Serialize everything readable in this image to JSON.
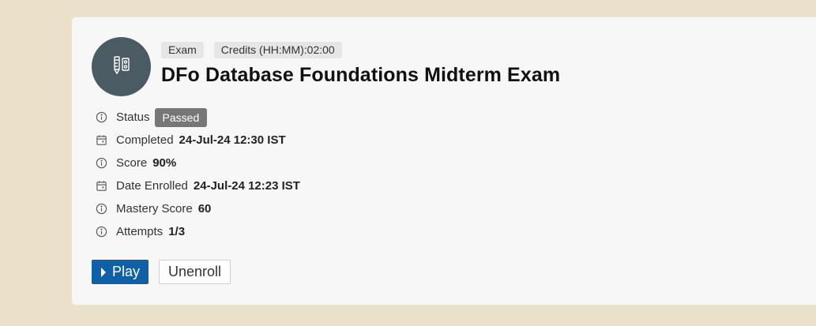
{
  "course": {
    "icon": "exam-pencil-icon",
    "tags": {
      "type": "Exam",
      "credits": "Credits (HH:MM):02:00"
    },
    "title": "DFo Database Foundations Midterm Exam"
  },
  "details": {
    "status": {
      "label": "Status",
      "value": "Passed",
      "icon": "info-icon"
    },
    "completed": {
      "label": "Completed",
      "value": "24-Jul-24 12:30 IST",
      "icon": "calendar-icon"
    },
    "score": {
      "label": "Score",
      "value": "90%",
      "icon": "info-icon"
    },
    "date_enrolled": {
      "label": "Date Enrolled",
      "value": "24-Jul-24 12:23 IST",
      "icon": "calendar-icon"
    },
    "mastery_score": {
      "label": "Mastery Score",
      "value": "60",
      "icon": "info-icon"
    },
    "attempts": {
      "label": "Attempts",
      "value": "1/3",
      "icon": "info-icon"
    }
  },
  "actions": {
    "play_label": "Play",
    "unenroll_label": "Unenroll"
  },
  "colors": {
    "page_background": "#ebe1cb",
    "card_background": "#f7f7f7",
    "avatar": "#4a5b63",
    "primary_button": "#1060a7",
    "status_badge": "#777777"
  }
}
